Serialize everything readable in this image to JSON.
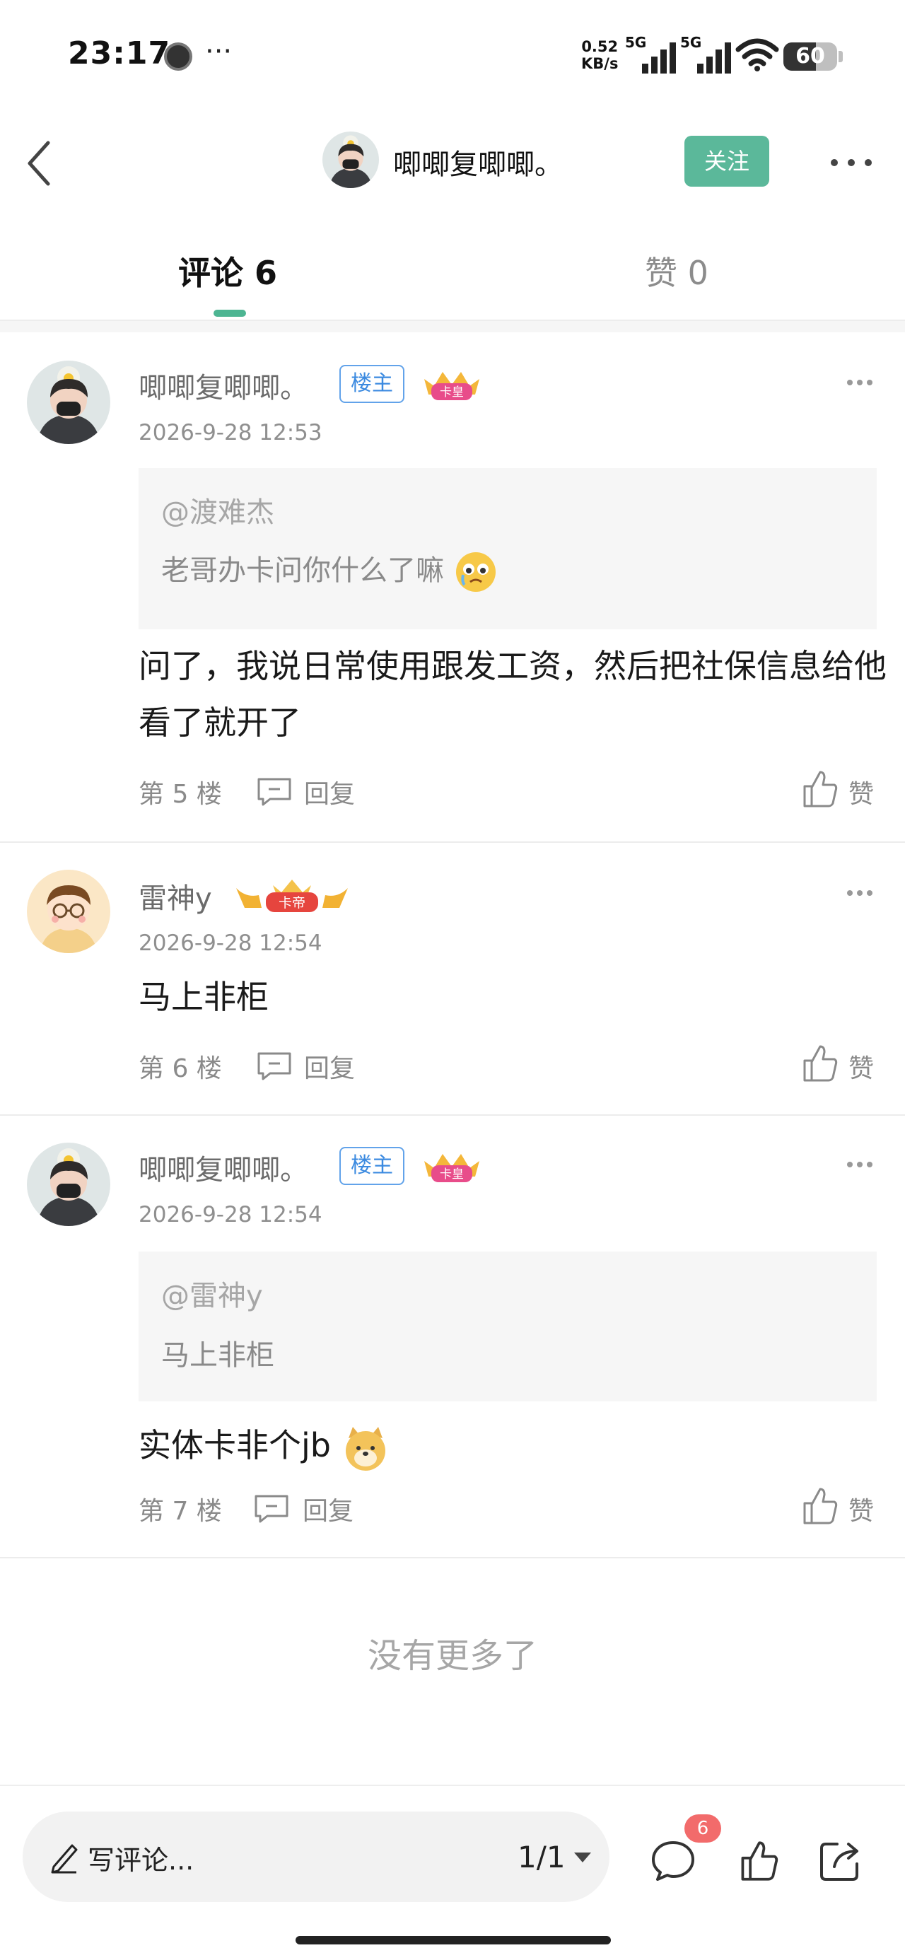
{
  "status_bar": {
    "time": "23:17",
    "dots": "···",
    "net_speed_value": "0.52",
    "net_speed_unit": "KB/s",
    "sim1_label": "5G",
    "sim2_label": "5G",
    "battery": "60",
    "battery_level": 0.6
  },
  "header": {
    "title": "唧唧复唧唧。",
    "follow_label": "关注",
    "back_icon": "chevron-left-icon",
    "more_icon": "more-dots-icon"
  },
  "tabs": {
    "comments_label": "评论 6",
    "likes_label": "赞 0",
    "active": "comments",
    "accent_color": "#4db592"
  },
  "comments": [
    {
      "name": "唧唧复唧唧。",
      "op_badge": "楼主",
      "level_badge": "卡皇",
      "time": "2026-9-28 12:53",
      "quote_user": "@渡难杰",
      "quote_text": "老哥办卡问你什么了嘛",
      "body": "问了，我说日常使用跟发工资，然后把社保信息给他看了就开了",
      "floor": "第 5 楼",
      "reply_label": "回复",
      "like_label": "赞"
    },
    {
      "name": "雷神y",
      "level_badge": "卡帝",
      "time": "2026-9-28 12:54",
      "body": "马上非柜",
      "floor": "第 6 楼",
      "reply_label": "回复",
      "like_label": "赞"
    },
    {
      "name": "唧唧复唧唧。",
      "op_badge": "楼主",
      "level_badge": "卡皇",
      "time": "2026-9-28 12:54",
      "quote_user": "@雷神y",
      "quote_text": "马上非柜",
      "body": "实体卡非个jb",
      "floor": "第 7 楼",
      "reply_label": "回复",
      "like_label": "赞"
    }
  ],
  "no_more": "没有更多了",
  "bottom_bar": {
    "write_placeholder": "写评论...",
    "page_indicator": "1/1",
    "comment_count": "6"
  }
}
